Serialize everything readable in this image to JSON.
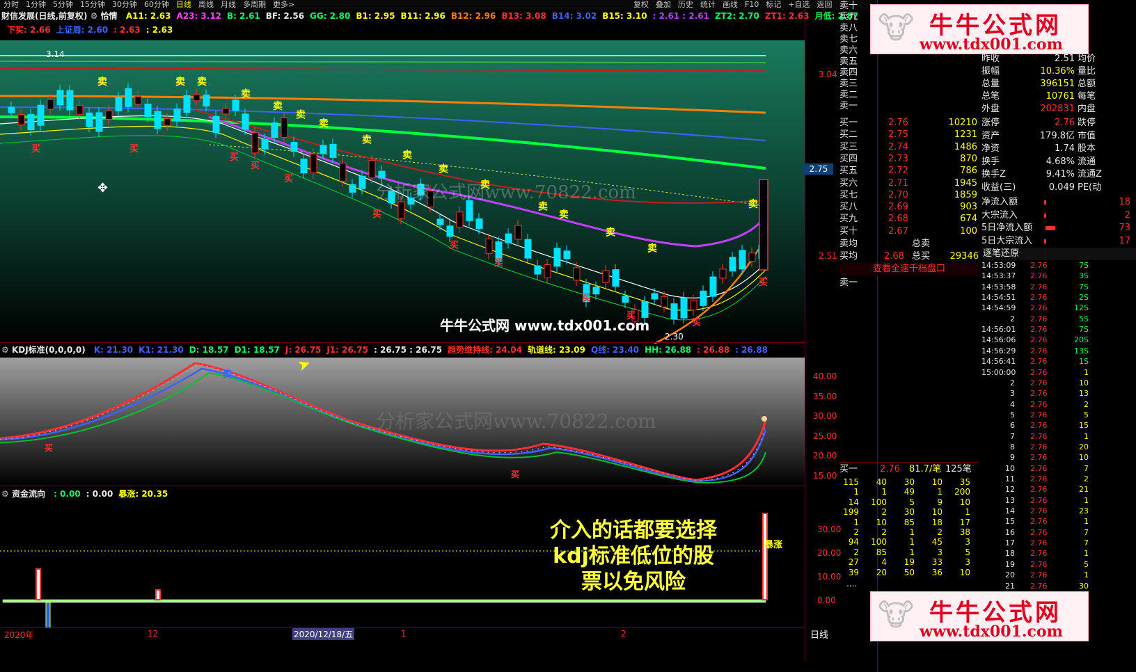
{
  "toolbar": {
    "tabs": [
      "分时",
      "1分钟",
      "5分钟",
      "15分钟",
      "30分钟",
      "60分钟",
      "日线",
      "周线",
      "月线",
      "多周期",
      "更多>"
    ],
    "right_buttons": [
      "复权",
      "叠加",
      "历史",
      "统计",
      "画线",
      "F10",
      "标记",
      "+自选",
      "返回"
    ]
  },
  "main": {
    "title": "财信发展(日线,前复权)",
    "indicator_name": "恰情",
    "params": [
      {
        "label": "A11: 2.63",
        "color": "#ffff00"
      },
      {
        "label": "A23: 3.12",
        "color": "#ff40ff"
      },
      {
        "label": "B: 2.61",
        "color": "#00ff60"
      },
      {
        "label": "BF: 2.56",
        "color": "#e8e8e8"
      },
      {
        "label": "GG: 2.80",
        "color": "#00ff60"
      },
      {
        "label": "B1: 2.95",
        "color": "#ffff00"
      },
      {
        "label": "B11: 2.96",
        "color": "#ffff00"
      },
      {
        "label": "B12: 2.96",
        "color": "#ff8000"
      },
      {
        "label": "B13: 3.08",
        "color": "#ff3030"
      },
      {
        "label": "B14: 3.02",
        "color": "#4060ff"
      },
      {
        "label": "B15: 3.10",
        "color": "#ffff00"
      },
      {
        "label": ": 2.61 : 2.61",
        "color": "#b040ff"
      },
      {
        "label": "ZT2: 2.70",
        "color": "#00ff60"
      },
      {
        "label": "ZT1: 2.63",
        "color": "#ff3030"
      },
      {
        "label": "月低: 2.87",
        "color": "#00ff60"
      }
    ],
    "row2": [
      {
        "label": "下买: 2.66",
        "color": "#ff3030"
      },
      {
        "label": "上证周: 2.60",
        "color": "#4060ff"
      },
      {
        "label": ": 2.63",
        "color": "#ff3030"
      },
      {
        "label": ": 2.63",
        "color": "#ffff00"
      }
    ],
    "price_axis": [
      "3.04",
      "2.75",
      "2.51"
    ],
    "current_price": "2.75",
    "high_label": "3.14",
    "low_label": "2.30",
    "watermark": "分析家公式网www.70822.com",
    "site_text": "牛牛公式网 www.tdx001.com",
    "buy_label": "买",
    "sell_label": "卖"
  },
  "kdj": {
    "title": "KDJ标准(0,0,0,0)",
    "params": [
      {
        "label": "K: 21.30",
        "color": "#4060ff"
      },
      {
        "label": "K1: 21.30",
        "color": "#4060ff"
      },
      {
        "label": "D: 18.57",
        "color": "#00ff60"
      },
      {
        "label": "D1: 18.57",
        "color": "#00ff60"
      },
      {
        "label": "J: 26.75",
        "color": "#ff3030"
      },
      {
        "label": "J1: 26.75",
        "color": "#ff3030"
      },
      {
        "label": ": 26.75 : 26.75",
        "color": "#e8e8e8"
      },
      {
        "label": "趋势维持线: 24.04",
        "color": "#ff3030"
      },
      {
        "label": "轨道线: 23.09",
        "color": "#ffff00"
      },
      {
        "label": "Q线: 23.40",
        "color": "#4060ff"
      },
      {
        "label": "HH: 26.88",
        "color": "#00ff60"
      },
      {
        "label": ": 26.88",
        "color": "#ff3030"
      },
      {
        "label": ": 26.88",
        "color": "#4060ff"
      }
    ],
    "axis": [
      "40.00",
      "35.00",
      "30.00",
      "25.00",
      "20.00",
      "15.00"
    ]
  },
  "fund": {
    "title": "资金流向",
    "params": [
      {
        "label": ": 0.00",
        "color": "#00ff60"
      },
      {
        "label": ": 0.00",
        "color": "#e8e8e8"
      },
      {
        "label": "暴涨: 20.35",
        "color": "#ffff00"
      }
    ],
    "axis": [
      "30.00",
      "20.00",
      "10.00",
      "0.00"
    ],
    "surge_label": "暴涨",
    "annotation": [
      "介入的话都要选择",
      "kdj标准低位的股",
      "票以免风险"
    ]
  },
  "date_axis": {
    "labels": [
      "2020年",
      "12",
      "2020/12/18/五",
      "1",
      "2"
    ],
    "period": "日线"
  },
  "quote": {
    "sell_levels": [
      "卖十",
      "卖九",
      "卖八",
      "卖七",
      "卖六",
      "卖五",
      "卖四",
      "卖三",
      "卖二",
      "卖一"
    ],
    "stats_left": [
      {
        "k": "昨收",
        "v": "2.51",
        "k2": "均价"
      },
      {
        "k": "振幅",
        "v": "10.36%",
        "k2": "量比"
      },
      {
        "k": "总量",
        "v": "396151",
        "k2": "总额"
      },
      {
        "k": "总笔",
        "v": "10761",
        "k2": "每笔"
      },
      {
        "k": "外盘",
        "v": "202831",
        "k2": "内盘"
      }
    ],
    "buy_levels": [
      {
        "l": "买一",
        "p": "2.76",
        "v": "10210"
      },
      {
        "l": "买二",
        "p": "2.75",
        "v": "1231"
      },
      {
        "l": "买三",
        "p": "2.74",
        "v": "1486"
      },
      {
        "l": "买四",
        "p": "2.73",
        "v": "870"
      },
      {
        "l": "买五",
        "p": "2.72",
        "v": "786"
      },
      {
        "l": "买六",
        "p": "2.71",
        "v": "1945"
      },
      {
        "l": "买七",
        "p": "2.70",
        "v": "1859"
      },
      {
        "l": "买八",
        "p": "2.69",
        "v": "903"
      },
      {
        "l": "买九",
        "p": "2.68",
        "v": "674"
      },
      {
        "l": "买十",
        "p": "2.67",
        "v": "100"
      }
    ],
    "stats_right": [
      {
        "k": "涨停",
        "v": "2.76",
        "k2": "跌停"
      },
      {
        "k": "资产",
        "v": "179.8亿",
        "k2": "市值"
      },
      {
        "k": "净资",
        "v": "1.74",
        "k2": "股本"
      },
      {
        "k": "换手",
        "v": "4.68%",
        "k2": "流通"
      },
      {
        "k": "换手Z",
        "v": "9.41%",
        "k2": "流通Z"
      },
      {
        "k": "收益(三)",
        "v": "0.049",
        "k2": "PE(动"
      }
    ],
    "flow": [
      {
        "k": "净流入额",
        "v": "18"
      },
      {
        "k": "大宗流入",
        "v": "2"
      },
      {
        "k": "5日净流入额",
        "v": "73"
      },
      {
        "k": "5日大宗流入",
        "v": "17"
      }
    ],
    "avg_sell_label": "卖均",
    "avg_sell_right": "总卖",
    "avg_buy_label": "买均",
    "avg_buy_price": "2.68",
    "avg_buy_right": "总买",
    "avg_buy_vol": "29346",
    "view_all": "查看全速千档盘口",
    "sell_one": "卖一",
    "queue_head": {
      "label": "买一",
      "price": "2.76",
      "pct": "81.7/笔",
      "count": "125笔"
    },
    "queue": [
      [
        "115",
        "40",
        "30",
        "10",
        "35"
      ],
      [
        "1",
        "1",
        "49",
        "1",
        "200"
      ],
      [
        "14",
        "100",
        "5",
        "9",
        "10"
      ],
      [
        "199",
        "2",
        "30",
        "10",
        "1"
      ],
      [
        "1",
        "10",
        "85",
        "18",
        "17"
      ],
      [
        "2",
        "2",
        "1",
        "2",
        "38"
      ],
      [
        "94",
        "100",
        "1",
        "45",
        "3"
      ],
      [
        "2",
        "85",
        "1",
        "3",
        "5"
      ],
      [
        "27",
        "4",
        "19",
        "33",
        "3"
      ],
      [
        "39",
        "20",
        "50",
        "36",
        "10"
      ]
    ],
    "queue_more": "....",
    "ticks_title": "逐笔还原",
    "ticks": [
      {
        "t": "14:53:09",
        "p": "2.76",
        "v": "7S"
      },
      {
        "t": "14:53:37",
        "p": "2.76",
        "v": "3S"
      },
      {
        "t": "14:53:58",
        "p": "2.76",
        "v": "7S"
      },
      {
        "t": "14:54:51",
        "p": "2.76",
        "v": "2S"
      },
      {
        "t": "14:54:59",
        "p": "2.76",
        "v": "12S"
      },
      {
        "t": "2",
        "p": "2.76",
        "v": "5S"
      },
      {
        "t": "14:56:01",
        "p": "2.76",
        "v": "7S"
      },
      {
        "t": "14:56:06",
        "p": "2.76",
        "v": "20S"
      },
      {
        "t": "14:56:29",
        "p": "2.76",
        "v": "13S"
      },
      {
        "t": "14:56:41",
        "p": "2.76",
        "v": "1S"
      },
      {
        "t": "15:00:00",
        "p": "2.76",
        "v": "1"
      },
      {
        "t": "2",
        "p": "2.76",
        "v": "10"
      },
      {
        "t": "3",
        "p": "2.76",
        "v": "13"
      },
      {
        "t": "4",
        "p": "2.76",
        "v": "2"
      },
      {
        "t": "5",
        "p": "2.76",
        "v": "5"
      },
      {
        "t": "6",
        "p": "2.76",
        "v": "15"
      },
      {
        "t": "7",
        "p": "2.76",
        "v": "1"
      },
      {
        "t": "8",
        "p": "2.76",
        "v": "20"
      },
      {
        "t": "9",
        "p": "2.76",
        "v": "10"
      },
      {
        "t": "10",
        "p": "2.76",
        "v": "7"
      },
      {
        "t": "11",
        "p": "2.76",
        "v": "2"
      },
      {
        "t": "12",
        "p": "2.76",
        "v": "21"
      },
      {
        "t": "13",
        "p": "2.76",
        "v": "1"
      },
      {
        "t": "14",
        "p": "2.76",
        "v": "23"
      },
      {
        "t": "15",
        "p": "2.76",
        "v": "1"
      },
      {
        "t": "16",
        "p": "2.76",
        "v": "7"
      },
      {
        "t": "17",
        "p": "2.76",
        "v": "7"
      },
      {
        "t": "18",
        "p": "2.76",
        "v": "1"
      },
      {
        "t": "19",
        "p": "2.76",
        "v": "5"
      },
      {
        "t": "20",
        "p": "2.76",
        "v": "1"
      },
      {
        "t": "21",
        "p": "2.76",
        "v": "30"
      }
    ]
  },
  "logo": {
    "name": "牛牛公式网",
    "url": "www.tdx001.com"
  }
}
